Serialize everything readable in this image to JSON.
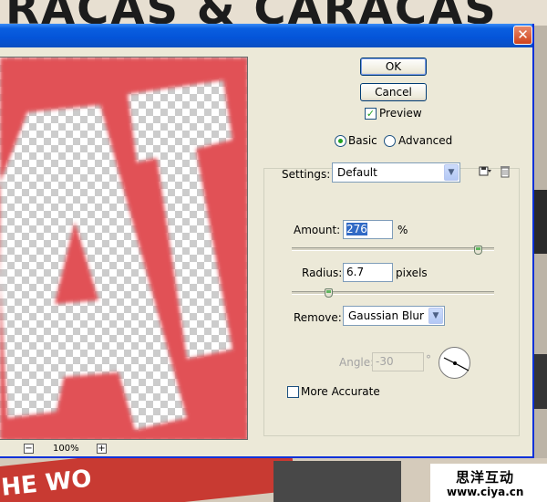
{
  "background": {
    "poster_title": "RACAS & CARACAS",
    "banner_text": "HE WO"
  },
  "dialog": {
    "close_label": "✕",
    "ok_label": "OK",
    "cancel_label": "Cancel",
    "preview_label": "Preview",
    "preview_checked": true,
    "mode_basic_label": "Basic",
    "mode_advanced_label": "Advanced",
    "mode_selected": "Basic",
    "settings_label": "Settings:",
    "settings_value": "Default",
    "amount_label": "Amount:",
    "amount_value": "276",
    "amount_unit": "%",
    "amount_slider_fraction": 0.92,
    "radius_label": "Radius:",
    "radius_value": "6.7",
    "radius_unit": "pixels",
    "radius_slider_fraction": 0.18,
    "remove_label": "Remove:",
    "remove_value": "Gaussian Blur",
    "angle_label": "Angle:",
    "angle_value": "-30",
    "angle_unit": "°",
    "more_accurate_label": "More Accurate",
    "more_accurate_checked": false,
    "zoom_out_label": "−",
    "zoom_value": "100%",
    "zoom_in_label": "+",
    "preview_letters": "AT"
  },
  "watermark": {
    "chinese": "思洋互动",
    "url": "www.ciya.cn"
  },
  "colors": {
    "titlebar": "#0454d8",
    "preview_red": "#e15156",
    "check_green": "#21a121"
  }
}
